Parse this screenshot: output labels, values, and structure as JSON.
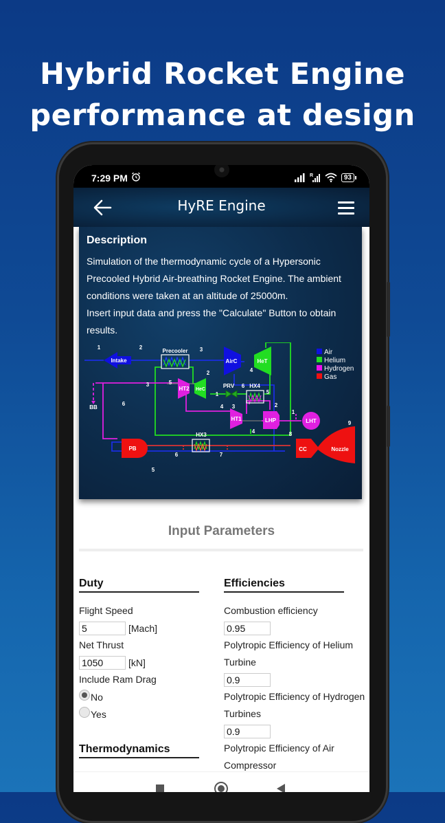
{
  "promo": {
    "title_line1": "Hybrid Rocket Engine",
    "title_line2": "performance at design point"
  },
  "status_bar": {
    "time": "7:29 PM",
    "battery": "93",
    "icons": [
      "alarm-icon",
      "signal-icon",
      "signal-roaming-icon",
      "wifi-icon",
      "battery-icon"
    ]
  },
  "app_bar": {
    "title": "HyRE Engine",
    "back_icon": "arrow-left-icon",
    "menu_icon": "hamburger-menu-icon"
  },
  "description": {
    "heading": "Description",
    "paragraph1": "Simulation of the thermodynamic cycle of a Hypersonic Precooled Hybrid Air-breathing Rocket Engine. The ambient conditions were taken at an altitude of 25000m.",
    "paragraph2": "Insert input data and press the \"Calculate\" Button to obtain results."
  },
  "diagram": {
    "components": {
      "intake": "Intake",
      "precooler": "Precooler",
      "airc": "AirC",
      "het": "HeT",
      "ht2": "HT2",
      "hec": "HeC",
      "prv": "PRV",
      "hx4": "HX4",
      "ht1": "HT1",
      "lhp": "LHP",
      "lht": "LHT",
      "pb": "PB",
      "hx3": "HX3",
      "cc": "CC",
      "nozzle": "Nozzle",
      "bb": "BB"
    },
    "legend": [
      {
        "label": "Air",
        "color": "#1010e0"
      },
      {
        "label": "Helium",
        "color": "#22dd22"
      },
      {
        "label": "Hydrogen",
        "color": "#ee10ee"
      },
      {
        "label": "Gas",
        "color": "#ee1111"
      }
    ],
    "station_labels": [
      "1",
      "2",
      "3",
      "2",
      "3",
      "5",
      "6",
      "4",
      "1",
      "6",
      "5",
      "4",
      "3",
      "2",
      "1",
      "8",
      "9",
      "4",
      "6",
      "7",
      "5"
    ]
  },
  "inputs": {
    "title": "Input Parameters",
    "duty": {
      "heading": "Duty",
      "flight_speed_label": "Flight Speed",
      "flight_speed_value": "5",
      "flight_speed_unit": "[Mach]",
      "net_thrust_label": "Net Thrust",
      "net_thrust_value": "1050",
      "net_thrust_unit": "[kN]",
      "ram_drag_label": "Include Ram Drag",
      "ram_drag_options": [
        "No",
        "Yes"
      ],
      "ram_drag_selected": "No"
    },
    "thermodynamics": {
      "heading": "Thermodynamics"
    },
    "efficiencies": {
      "heading": "Efficiencies",
      "combustion_label": "Combustion efficiency",
      "combustion_value": "0.95",
      "helium_turbine_label": "Polytropic Efficiency of Helium Turbine",
      "helium_turbine_value": "0.9",
      "hydrogen_turbines_label": "Polytropic Efficiency of Hydrogen Turbines",
      "hydrogen_turbines_value": "0.9",
      "air_compressor_label": "Polytropic Efficiency of Air Compressor"
    }
  }
}
